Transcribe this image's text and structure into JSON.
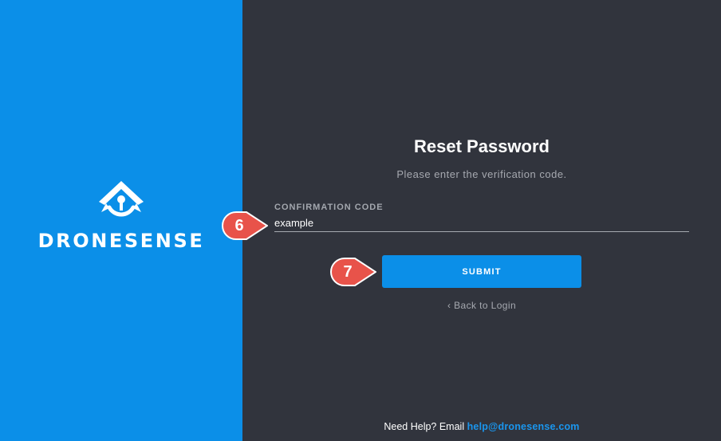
{
  "brand": {
    "name": "DRONESENSE",
    "color": "#0b8fe8"
  },
  "form": {
    "title": "Reset Password",
    "subtitle": "Please enter the verification code.",
    "confirmation_label": "CONFIRMATION CODE",
    "confirmation_value": "example",
    "submit_label": "SUBMIT",
    "back_arrow": "‹",
    "back_label": "Back to Login"
  },
  "help": {
    "prefix": "Need Help? Email",
    "email": "help@dronesense.com"
  },
  "annotations": [
    {
      "number": "6",
      "color": "#e8534a"
    },
    {
      "number": "7",
      "color": "#e8534a"
    }
  ],
  "colors": {
    "background_dark": "#31343d",
    "accent": "#0b8fe8",
    "muted_text": "#a6a9b0"
  },
  "icons": {
    "logo": "dronesense-logo-icon",
    "back": "chevron-left-icon"
  }
}
